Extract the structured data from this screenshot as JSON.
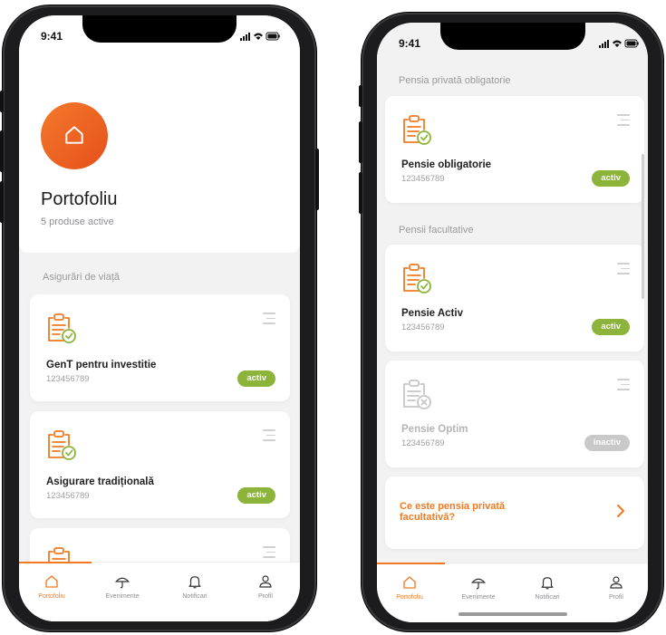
{
  "colors": {
    "accent": "#f07a23",
    "active_badge": "#8cb43a",
    "inactive_badge": "#c9c9c9",
    "muted_icon": "#c6c6c6"
  },
  "phone1": {
    "status": {
      "time": "9:41"
    },
    "header": {
      "title": "Portofoliu",
      "subtitle": "5 produse active",
      "avatar_icon": "home-icon"
    },
    "section_title": "Asigurări de viață",
    "cards": [
      {
        "icon": "clipboard-check-icon",
        "name": "GenT pentru  investitie",
        "number": "123456789",
        "status": "activ"
      },
      {
        "icon": "clipboard-check-icon",
        "name": "Asigurare tradițională",
        "number": "123456789",
        "status": "activ"
      },
      {
        "icon": "clipboard-check-icon"
      }
    ],
    "tabbar": [
      {
        "label": "Portofoliu",
        "icon": "home-icon",
        "active": true
      },
      {
        "label": "Evenimente",
        "icon": "umbrella-icon"
      },
      {
        "label": "Notificari",
        "icon": "bell-icon"
      },
      {
        "label": "Profil",
        "icon": "user-icon"
      }
    ]
  },
  "phone2": {
    "status": {
      "time": "9:41"
    },
    "sections": [
      {
        "title": "Pensia privată obligatorie"
      },
      {
        "title": "Pensii facultative"
      }
    ],
    "cards": [
      {
        "icon": "clipboard-check-icon",
        "name": "Pensie obligatorie",
        "number": "123456789",
        "status": "activ"
      },
      {
        "icon": "clipboard-check-icon",
        "name": "Pensie Activ",
        "number": "123456789",
        "status": "activ"
      },
      {
        "icon": "clipboard-x-icon",
        "name": "Pensie Optim",
        "number": "123456789",
        "status": "inactiv"
      }
    ],
    "info_link": {
      "text": "Ce este pensia privată facultativă?",
      "icon": "chevron-right-icon"
    },
    "tabbar": [
      {
        "label": "Portofoliu",
        "icon": "home-icon",
        "active": true
      },
      {
        "label": "Evenimente",
        "icon": "umbrella-icon"
      },
      {
        "label": "Notificari",
        "icon": "bell-icon"
      },
      {
        "label": "Profil",
        "icon": "user-icon"
      }
    ]
  }
}
